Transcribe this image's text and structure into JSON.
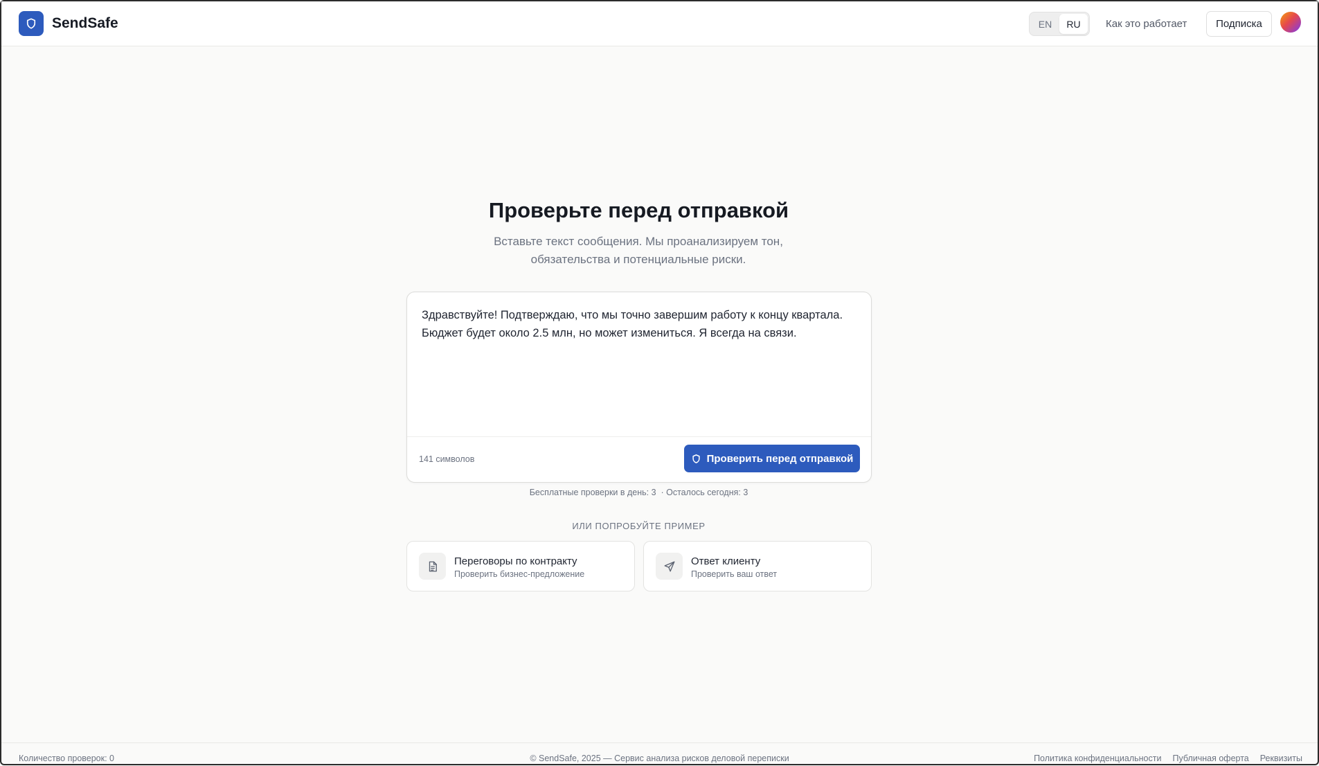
{
  "header": {
    "app_name": "SendSafe",
    "lang": {
      "en": "EN",
      "ru": "RU",
      "active": "RU"
    },
    "how_it_works": "Как это работает",
    "subscription": "Подписка"
  },
  "main": {
    "title": "Проверьте перед отправкой",
    "subtitle": "Вставьте текст сообщения. Мы проанализируем тон, обязательства и потенциальные риски.",
    "message_text": "Здравствуйте! Подтверждаю, что мы точно завершим работу к концу квартала. Бюджет будет около 2.5 млн, но может измениться. Я всегда на связи.",
    "char_count": "141 символов",
    "check_button": "Проверить перед отправкой",
    "quota": "Бесплатные проверки в день: 3  · Осталось сегодня: 3",
    "or_try": "ИЛИ ПОПРОБУЙТЕ ПРИМЕР",
    "examples": [
      {
        "title": "Переговоры по контракту",
        "subtitle": "Проверить бизнес-предложение",
        "icon": "document-icon"
      },
      {
        "title": "Ответ клиенту",
        "subtitle": "Проверить ваш ответ",
        "icon": "send-icon"
      }
    ]
  },
  "footer": {
    "checks_count": "Количество проверок: 0",
    "copyright": "© SendSafe, 2025 — Сервис анализа рисков деловой переписки",
    "links": [
      "Политика конфиденциальности",
      "Публичная оферта",
      "Реквизиты"
    ]
  },
  "colors": {
    "accent": "#2d5bbd",
    "background": "#fafaf9"
  }
}
